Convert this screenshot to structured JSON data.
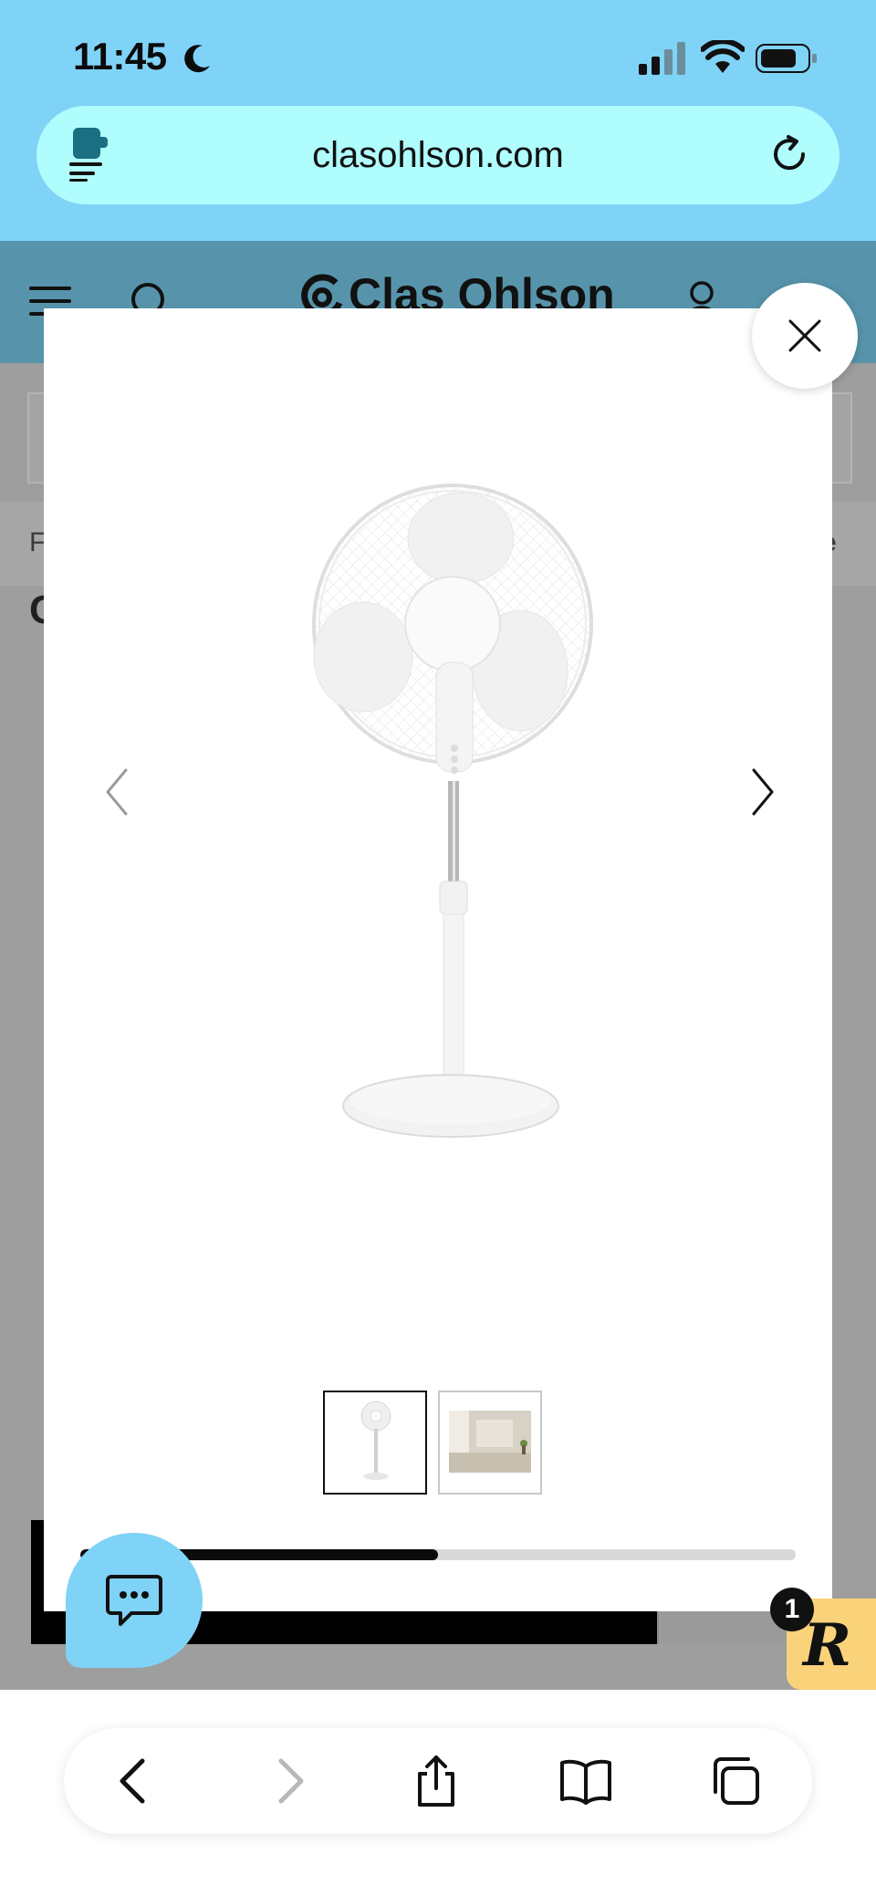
{
  "status_bar": {
    "time": "11:45",
    "icons": [
      "moon-icon",
      "signal-icon",
      "wifi-icon",
      "battery-icon"
    ]
  },
  "browser": {
    "url": "clasohlson.com",
    "icons": [
      "extension-icon",
      "reload-icon"
    ]
  },
  "site_header": {
    "logo_text": "Clas Ohlson",
    "icons": [
      "hamburger-menu-icon",
      "search-icon",
      "user-icon"
    ]
  },
  "background_page": {
    "left_fragment": "F",
    "right_fragment": "fte",
    "heading_fragment": "C"
  },
  "gallery": {
    "current_index": 0,
    "thumbnails": [
      "standing-fan-thumbnail",
      "room-scene-thumbnail"
    ],
    "progress": 0.5
  },
  "badges": {
    "r_letter": "R",
    "r_count": "1"
  },
  "colors": {
    "sky": "#7fd3f7",
    "url_bar": "#b0fdfd",
    "header_dim": "#5794ac",
    "badge": "#f9d27a"
  }
}
